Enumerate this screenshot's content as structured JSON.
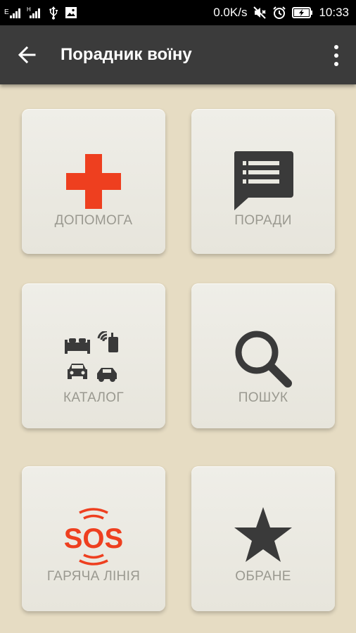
{
  "status_bar": {
    "speed": "0.0K/s",
    "time": "10:33"
  },
  "app_bar": {
    "title": "Порадник воїну",
    "back_icon": "arrow-back-icon",
    "menu_icon": "more-vert-icon"
  },
  "tiles": [
    {
      "label": "ДОПОМОГА",
      "icon": "red-cross-icon"
    },
    {
      "label": "ПОРАДИ",
      "icon": "chat-list-icon"
    },
    {
      "label": "КАТАЛОГ",
      "icon": "catalog-icon"
    },
    {
      "label": "ПОШУК",
      "icon": "search-icon"
    },
    {
      "label": "ГАРЯЧА ЛІНІЯ",
      "icon": "sos-icon",
      "icon_text": "SOS"
    },
    {
      "label": "ОБРАНЕ",
      "icon": "star-icon"
    }
  ],
  "colors": {
    "background": "#e6dcc3",
    "app_bar": "#3b3b3b",
    "accent_red": "#ee3f1f",
    "icon_dark": "#3a3a3a",
    "label_gray": "#9a9990"
  }
}
